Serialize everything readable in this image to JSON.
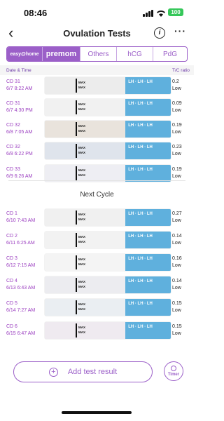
{
  "status_bar": {
    "time": "08:46",
    "battery": "100"
  },
  "nav": {
    "title": "Ovulation Tests",
    "info_glyph": "i",
    "more_glyph": "···",
    "back_glyph": "‹"
  },
  "brand_tabs": [
    {
      "label": "easy@home",
      "active": true
    },
    {
      "label": "premom",
      "active": true
    },
    {
      "label": "Others",
      "active": false
    },
    {
      "label": "hCG",
      "active": false
    },
    {
      "label": "PdG",
      "active": false
    }
  ],
  "columns": {
    "date_time": "Date & Time",
    "ratio": "T/C ratio"
  },
  "strip_text": {
    "max": "MAX",
    "brand": "LH"
  },
  "cycle_1": [
    {
      "cd": "CD 31",
      "datetime": "6/7 8:22 AM",
      "ratio": "0.2",
      "level": "Low"
    },
    {
      "cd": "CD 31",
      "datetime": "6/7 4:30 PM",
      "ratio": "0.09",
      "level": "Low"
    },
    {
      "cd": "CD 32",
      "datetime": "6/8 7:05 AM",
      "ratio": "0.19",
      "level": "Low"
    },
    {
      "cd": "CD 32",
      "datetime": "6/8 6:22 PM",
      "ratio": "0.23",
      "level": "Low"
    },
    {
      "cd": "CD 33",
      "datetime": "6/9 6:26 AM",
      "ratio": "0.19",
      "level": "Low"
    }
  ],
  "divider_label": "Next Cycle",
  "cycle_2": [
    {
      "cd": "CD 1",
      "datetime": "6/10 7:43 AM",
      "ratio": "0.27",
      "level": "Low"
    },
    {
      "cd": "CD 2",
      "datetime": "6/11 6:25 AM",
      "ratio": "0.14",
      "level": "Low"
    },
    {
      "cd": "CD 3",
      "datetime": "6/12 7:15 AM",
      "ratio": "0.16",
      "level": "Low"
    },
    {
      "cd": "CD 4",
      "datetime": "6/13 6:43 AM",
      "ratio": "0.14",
      "level": "Low"
    },
    {
      "cd": "CD 5",
      "datetime": "6/14 7:27 AM",
      "ratio": "0.15",
      "level": "Low"
    },
    {
      "cd": "CD 6",
      "datetime": "6/15 6:47 AM",
      "ratio": "0.15",
      "level": "Low"
    }
  ],
  "actions": {
    "add_label": "Add test result",
    "timer_label": "Timer"
  },
  "colors": {
    "accent": "#9b5fc8",
    "date_text": "#9b3fc0",
    "strip_blue": "#5fb0dd",
    "test_line": "#d86a86"
  },
  "icons": {
    "back": "chevron-left-icon",
    "info": "info-icon",
    "more": "more-icon",
    "add": "plus-circle-icon",
    "timer": "clock-icon",
    "signal": "cellular-signal-icon",
    "wifi": "wifi-icon",
    "battery": "battery-icon"
  }
}
